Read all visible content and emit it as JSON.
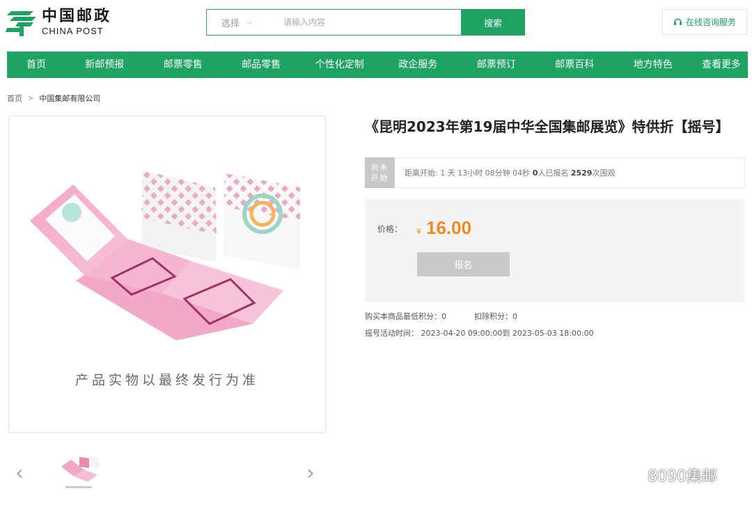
{
  "header": {
    "logo_cn": "中国邮政",
    "logo_en": "CHINA POST",
    "search": {
      "select_label": "选择",
      "placeholder": "请输入内容",
      "button_label": "搜索"
    },
    "service_label": "在线咨询服务"
  },
  "nav": {
    "items": [
      "首页",
      "新邮预报",
      "邮票零售",
      "邮品零售",
      "个性化定制",
      "政企服务",
      "邮票预订",
      "邮票百科",
      "地方特色",
      "查看更多"
    ]
  },
  "breadcrumb": {
    "home": "首页",
    "current": "中国集邮有限公司"
  },
  "product": {
    "image_caption": "产品实物以最终发行为准",
    "title": "《昆明2023年第19届中华全国集邮展览》特供折【摇号】",
    "status_tag_line1": "尚未",
    "status_tag_line2": "开始",
    "countdown_prefix": "距离开始: 1 天 13小时 08分钟 04秒 ",
    "signed_count": "0",
    "signed_suffix": "人已报名 ",
    "view_count": "2529",
    "view_suffix": "次围观",
    "price_label": "价格：",
    "currency": "¥",
    "price": "16.00",
    "signup_button": "报名",
    "min_points": "购买本商品最低积分：0",
    "deduct_points": "扣除积分：0",
    "activity_time": "摇号活动时间： 2023-04-20 09:00:00到 2023-05-03 18:00:00"
  },
  "watermark": "8090集邮",
  "colors": {
    "brand_green": "#1ea362",
    "price_orange": "#f08a1e",
    "disabled_gray": "#c9c9c9"
  }
}
